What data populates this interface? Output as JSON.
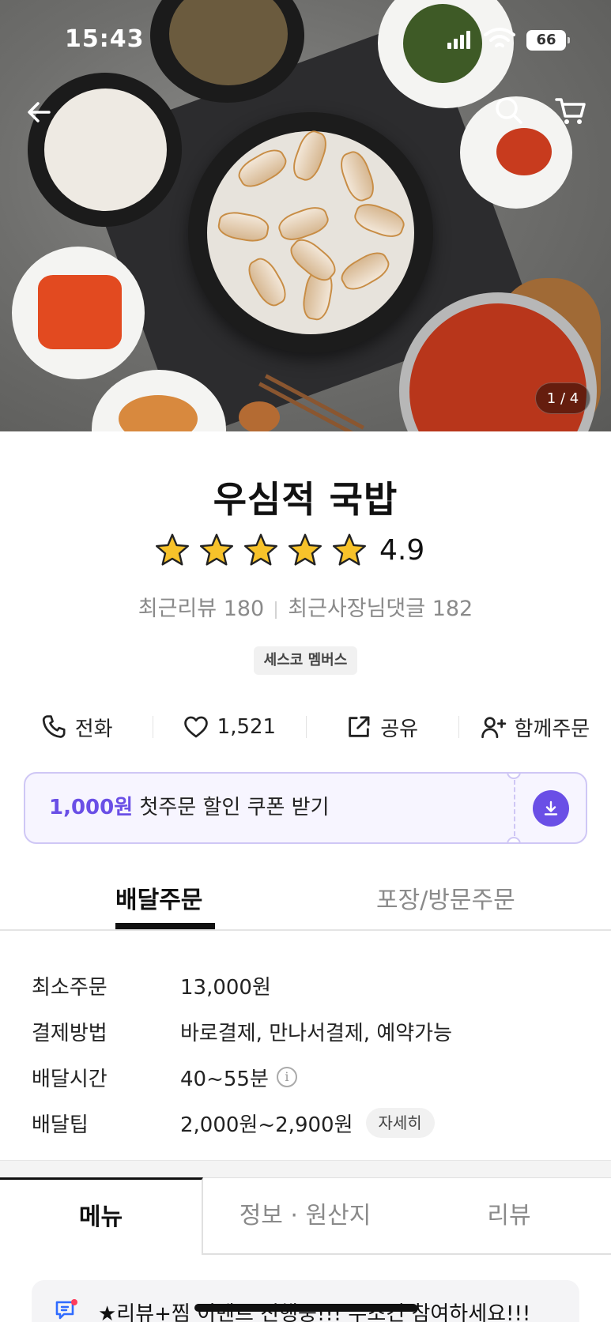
{
  "status_bar": {
    "time": "15:43",
    "battery": "66"
  },
  "hero": {
    "image_counter": "1 / 4"
  },
  "store": {
    "name": "우심적 국밥",
    "rating": "4.9",
    "stars": 5,
    "recent_reviews": "최근리뷰 180",
    "owner_replies": "최근사장님댓글 182",
    "member_badge": "세스코 멤버스"
  },
  "actions": {
    "call": "전화",
    "likes": "1,521",
    "share": "공유",
    "group_order": "함께주문"
  },
  "coupon": {
    "amount": "1,000원",
    "text": "첫주문 할인 쿠폰 받기"
  },
  "order_tabs": {
    "delivery": "배달주문",
    "pickup": "포장/방문주문"
  },
  "info": {
    "min_order_label": "최소주문",
    "min_order": "13,000원",
    "payment_label": "결제방법",
    "payment": "바로결제, 만나서결제, 예약가능",
    "delivery_time_label": "배달시간",
    "delivery_time": "40~55분",
    "tip_label": "배달팁",
    "tip": "2,000원~2,900원",
    "detail_button": "자세히"
  },
  "menu_tabs": {
    "menu": "메뉴",
    "info": "정보 · 원산지",
    "review": "리뷰"
  },
  "notice": {
    "text": "★리뷰+찜 이벤트 진행중!!! 무조건 참여하세요!!!"
  },
  "colors": {
    "accent": "#6a4fe6",
    "star": "#f7c22a"
  }
}
